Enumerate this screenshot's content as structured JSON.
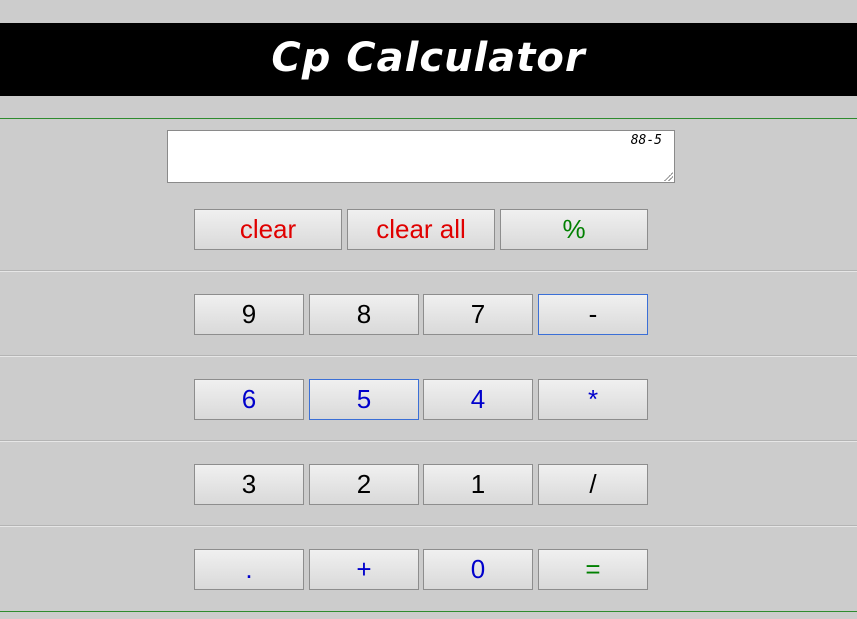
{
  "app": {
    "title": "Cp Calculator"
  },
  "display": {
    "expression": "88-5"
  },
  "colors": {
    "background": "#cccccc",
    "title_bar": "#000000",
    "title_text": "#ffffff",
    "clear_text": "#e00000",
    "percent_text": "#008000",
    "blue_row_text": "#0000cc",
    "equals_text": "#008000"
  },
  "buttons": {
    "clear": "clear",
    "clear_all": "clear all",
    "percent": "%",
    "nine": "9",
    "eight": "8",
    "seven": "7",
    "minus": "-",
    "six": "6",
    "five": "5",
    "four": "4",
    "multiply": "*",
    "three": "3",
    "two": "2",
    "one": "1",
    "divide": "/",
    "dot": ".",
    "plus": "+",
    "zero": "0",
    "equals": "="
  }
}
